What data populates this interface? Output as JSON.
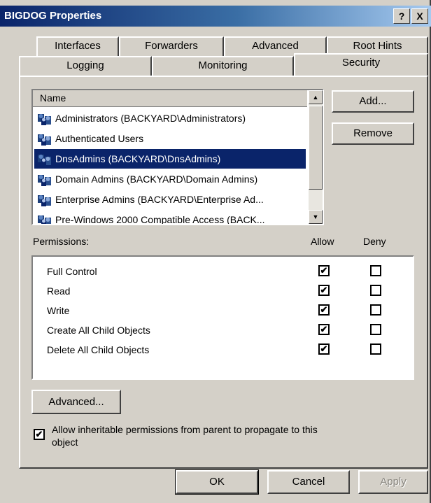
{
  "window": {
    "title": "BIGDOG Properties",
    "help_button": "?",
    "close_button": "X"
  },
  "tabs": {
    "row1": [
      "Interfaces",
      "Forwarders",
      "Advanced",
      "Root Hints"
    ],
    "row2": [
      "Logging",
      "Monitoring",
      "Security"
    ],
    "active": "Security"
  },
  "names_list": {
    "header": "Name",
    "items": [
      "Administrators (BACKYARD\\Administrators)",
      "Authenticated Users",
      "DnsAdmins (BACKYARD\\DnsAdmins)",
      "Domain Admins (BACKYARD\\Domain Admins)",
      "Enterprise Admins (BACKYARD\\Enterprise Ad...",
      "Pre-Windows 2000 Compatible Access (BACK..."
    ],
    "selected_index": 2
  },
  "buttons": {
    "add": "Add...",
    "remove": "Remove",
    "advanced": "Advanced...",
    "ok": "OK",
    "cancel": "Cancel",
    "apply": "Apply"
  },
  "permissions": {
    "label": "Permissions:",
    "allow_header": "Allow",
    "deny_header": "Deny",
    "rows": [
      {
        "name": "Full Control",
        "allow": true,
        "deny": false
      },
      {
        "name": "Read",
        "allow": true,
        "deny": false
      },
      {
        "name": "Write",
        "allow": true,
        "deny": false
      },
      {
        "name": "Create All Child Objects",
        "allow": true,
        "deny": false
      },
      {
        "name": "Delete All Child Objects",
        "allow": true,
        "deny": false
      }
    ]
  },
  "inherit": {
    "checked": true,
    "label_line1": "Allow inheritable permissions from parent to propagate to this",
    "label_line2": "object"
  },
  "icons": {
    "group": "group-icon",
    "check": "✔"
  }
}
